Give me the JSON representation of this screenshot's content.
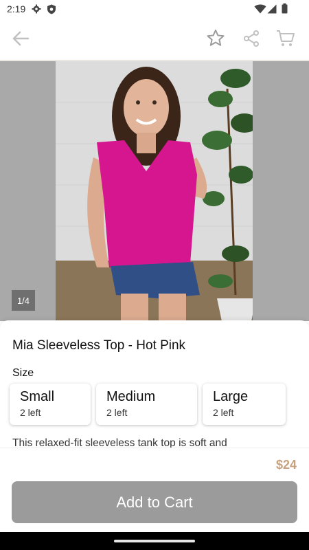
{
  "status_bar": {
    "time": "2:19"
  },
  "app_bar": {
    "back_icon": "arrow-left-icon",
    "favorite_icon": "star-icon",
    "share_icon": "share-icon",
    "cart_icon": "cart-icon"
  },
  "gallery": {
    "counter": "1/4"
  },
  "product": {
    "name": "Mia Sleeveless Top - Hot Pink",
    "size_heading": "Size",
    "sizes": [
      {
        "label": "Small",
        "stock": "2 left"
      },
      {
        "label": "Medium",
        "stock": "2 left"
      },
      {
        "label": "Large",
        "stock": "2 left"
      }
    ],
    "description": "This relaxed-fit sleeveless tank top is soft and",
    "price": "$24"
  },
  "actions": {
    "add_to_cart": "Add to Cart"
  },
  "colors": {
    "accent": "#c7a27f",
    "button": "#9b9b9b",
    "top_pink": "#d6168f"
  }
}
